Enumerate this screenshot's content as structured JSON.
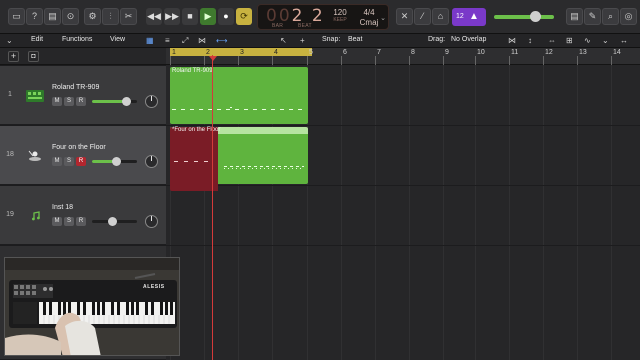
{
  "control_bar": {
    "lcd": {
      "bars_dim": "00",
      "bar": "2",
      "beat": "2",
      "captions": [
        "BAR",
        "BEAT"
      ],
      "tempo": "120",
      "tempo_caption": "KEEP",
      "signature": "4/4",
      "key": "Cmaj"
    },
    "count_in": "1234"
  },
  "toolbar": {
    "menus": [
      "Edit",
      "Functions",
      "View"
    ],
    "snap_label": "Snap:",
    "snap_value": "Beat",
    "drag_label": "Drag:",
    "drag_value": "No Overlap"
  },
  "ruler": {
    "bars": [
      "1",
      "2",
      "3",
      "4",
      "5",
      "6",
      "7",
      "8",
      "9",
      "10",
      "11",
      "12",
      "13",
      "14"
    ]
  },
  "tracks": [
    {
      "number": "1",
      "name": "Roland TR-909",
      "buttons": [
        "M",
        "S",
        "R"
      ],
      "record_armed": false,
      "volume": 0.78,
      "icon": "drum-machine-icon"
    },
    {
      "number": "18",
      "name": "Four on the Floor",
      "buttons": [
        "M",
        "S",
        "R"
      ],
      "record_armed": true,
      "volume": 0.55,
      "icon": "drummer-icon"
    },
    {
      "number": "19",
      "name": "Inst 18",
      "buttons": [
        "M",
        "S",
        "R"
      ],
      "record_armed": false,
      "volume": 0.45,
      "icon": "music-note-icon"
    }
  ],
  "regions": [
    {
      "name": "Roland TR-909",
      "color": "#5fb43e"
    },
    {
      "name": "*Four on the Floor",
      "color": "#5fb43e",
      "recording_color": "#7a1c26"
    }
  ],
  "video_overlay": {
    "brand": "ALESIS"
  },
  "colors": {
    "accent_green": "#6cc04a",
    "playhead": "#d43a3a",
    "cycle": "#c8b240",
    "record": "#b3262e",
    "count_in": "#7a39c9"
  }
}
